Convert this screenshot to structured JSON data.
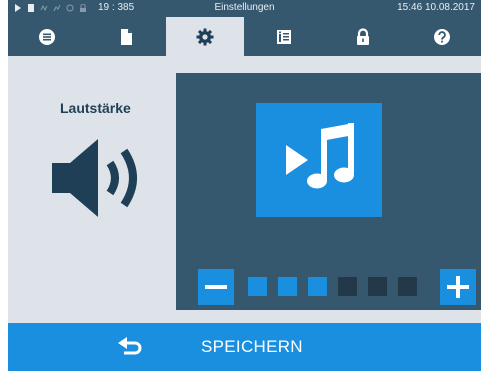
{
  "status": {
    "counter": "19 : 385",
    "title": "Einstellungen",
    "time": "15:46",
    "date": "10.08.2017"
  },
  "tabs": [
    {
      "icon": "menu-icon"
    },
    {
      "icon": "document-icon"
    },
    {
      "icon": "gear-icon",
      "active": true
    },
    {
      "icon": "info-panel-icon"
    },
    {
      "icon": "lock-icon"
    },
    {
      "icon": "help-icon"
    }
  ],
  "volume": {
    "label": "Lautstärke",
    "level": 3,
    "max": 6
  },
  "bottom": {
    "save_label": "SPEICHERN",
    "back_icon": "back-arrow-icon"
  },
  "colors": {
    "header": "#35586f",
    "accent": "#1a8fe0",
    "background": "#dde3e8"
  }
}
